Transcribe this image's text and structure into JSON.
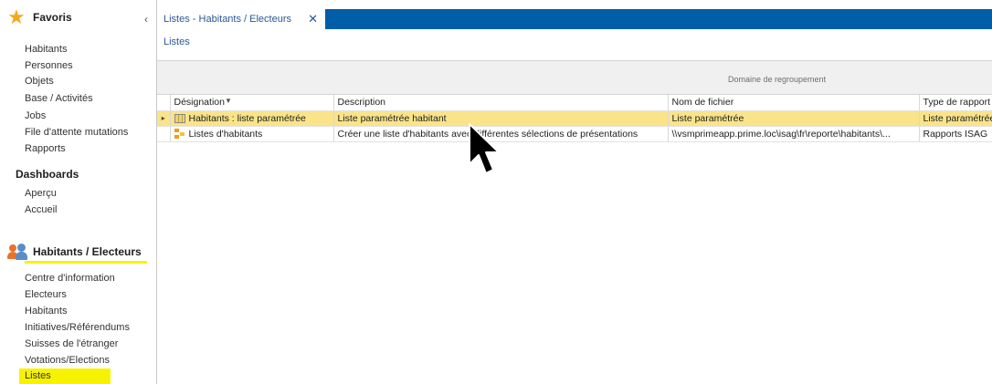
{
  "sidebar": {
    "favorites": {
      "title": "Favoris",
      "collapse_glyph": "‹",
      "items": [
        "Habitants",
        "Personnes",
        "Objets",
        "Base / Activités",
        "Jobs",
        "File d'attente mutations",
        "Rapports"
      ]
    },
    "dashboards": {
      "title": "Dashboards",
      "items": [
        "Aperçu",
        "Accueil"
      ]
    },
    "module": {
      "title": "Habitants / Electeurs",
      "icon": "users-icon",
      "items": [
        "Centre d'information",
        "Electeurs",
        "Habitants",
        "Initiatives/Référendums",
        "Suisses de l'étranger",
        "Votations/Elections",
        "Listes"
      ],
      "selected": "Listes"
    }
  },
  "tabbar": {
    "tab_label": "Listes - Habitants / Electeurs",
    "close_glyph": "✕"
  },
  "breadcrumb": "Listes",
  "grouping": {
    "label": "Domaine de regroupement"
  },
  "table": {
    "columns": [
      "Désignation",
      "Description",
      "Nom de fichier",
      "Type de rapport"
    ],
    "rows": [
      {
        "indicator": "▸",
        "icon": "grid-report-icon",
        "designation": "Habitants : liste paramétrée",
        "description": "Liste paramétrée habitant",
        "filename": "Liste paramétrée",
        "type": "Liste paramétrée",
        "selected": true
      },
      {
        "indicator": "",
        "icon": "report-icon",
        "designation": "Listes d'habitants",
        "description": "Créer une liste d'habitants avec différentes sélections de présentations",
        "filename": "\\\\vsmprimeapp.prime.loc\\isag\\fr\\reporte\\habitants\\...",
        "type": "Rapports ISAG",
        "selected": false
      }
    ]
  },
  "colors": {
    "tabbar": "#005da8",
    "selected_row": "#f9e48a",
    "highlight": "#f7f300",
    "star": "#f5a81c",
    "link": "#2b5797"
  }
}
